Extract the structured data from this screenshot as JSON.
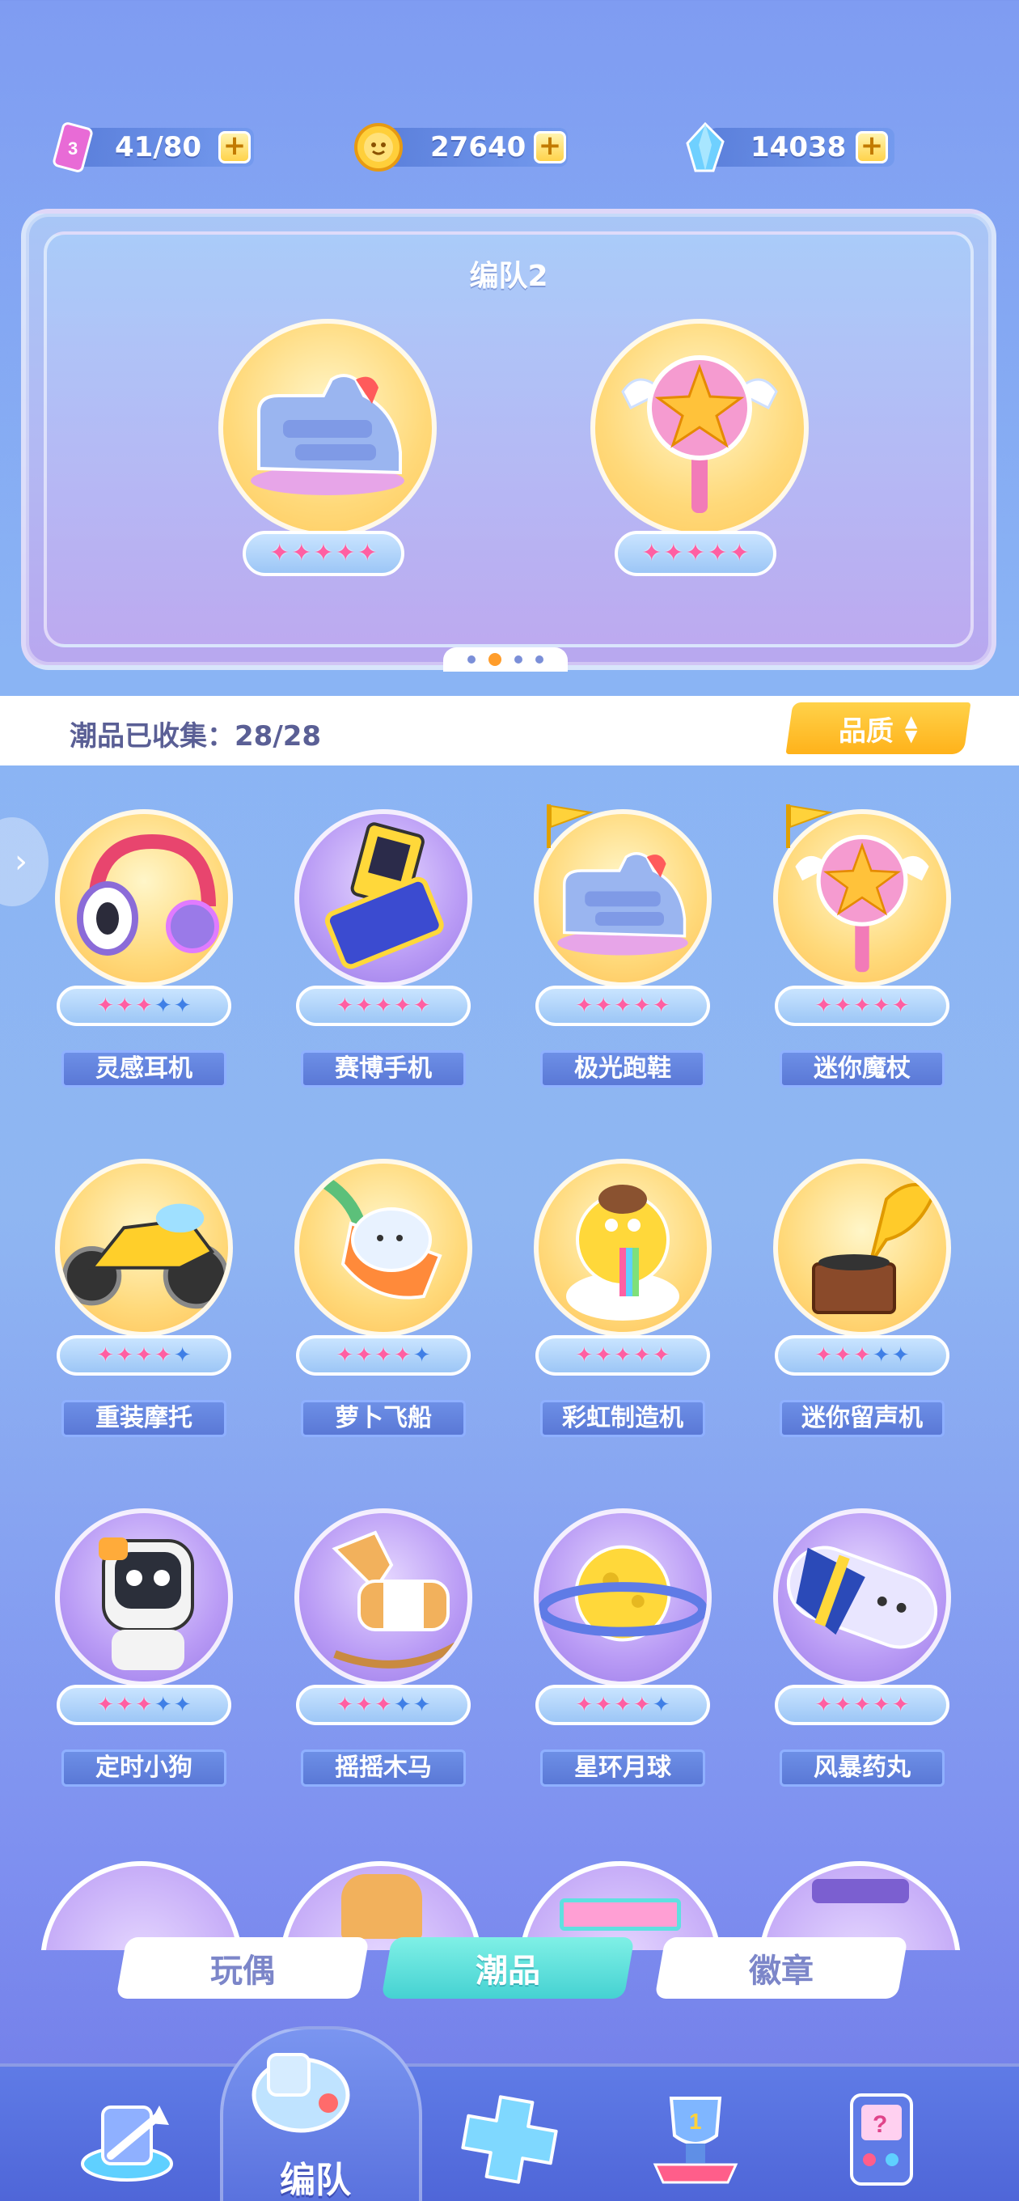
{
  "currencies": [
    {
      "name": "stamina",
      "value": "41/80",
      "icon": "energy-ticket-icon"
    },
    {
      "name": "coins",
      "value": "27640",
      "icon": "gold-coin-icon"
    },
    {
      "name": "crystals",
      "value": "14038",
      "icon": "crystal-icon"
    }
  ],
  "plus_label": "+",
  "team": {
    "title": "编队2",
    "slots": [
      {
        "item": "sneaker",
        "stars": 5,
        "max_stars": 5
      },
      {
        "item": "magic-wand",
        "stars": 5,
        "max_stars": 5
      }
    ],
    "pages": 4,
    "current_page": 2
  },
  "collection": {
    "label": "潮品已收集：28/28",
    "sort_label": "品质",
    "sort_icon": "⇕"
  },
  "items": [
    {
      "name": "灵感耳机",
      "stars": 3,
      "max_stars": 5,
      "bg": "gold",
      "icon": "headphones-icon",
      "flag": false
    },
    {
      "name": "赛博手机",
      "stars": 5,
      "max_stars": 5,
      "bg": "purple",
      "icon": "flip-phone-icon",
      "flag": false
    },
    {
      "name": "极光跑鞋",
      "stars": 5,
      "max_stars": 5,
      "bg": "gold",
      "icon": "sneaker-icon",
      "flag": true
    },
    {
      "name": "迷你魔杖",
      "stars": 5,
      "max_stars": 5,
      "bg": "gold",
      "icon": "magic-wand-icon",
      "flag": true
    },
    {
      "name": "重装摩托",
      "stars": 4,
      "max_stars": 5,
      "bg": "gold",
      "icon": "motorcycle-icon",
      "flag": false
    },
    {
      "name": "萝卜飞船",
      "stars": 4,
      "max_stars": 5,
      "bg": "gold",
      "icon": "carrot-ship-icon",
      "flag": false
    },
    {
      "name": "彩虹制造机",
      "stars": 5,
      "max_stars": 5,
      "bg": "gold",
      "icon": "rainbow-machine-icon",
      "flag": false
    },
    {
      "name": "迷你留声机",
      "stars": 3,
      "max_stars": 5,
      "bg": "gold",
      "icon": "gramophone-icon",
      "flag": false
    },
    {
      "name": "定时小狗",
      "stars": 3,
      "max_stars": 5,
      "bg": "purple",
      "icon": "robot-dog-icon",
      "flag": false
    },
    {
      "name": "摇摇木马",
      "stars": 3,
      "max_stars": 5,
      "bg": "purple",
      "icon": "rocking-horse-icon",
      "flag": false
    },
    {
      "name": "星环月球",
      "stars": 4,
      "max_stars": 5,
      "bg": "purple",
      "icon": "ringed-moon-icon",
      "flag": false
    },
    {
      "name": "风暴药丸",
      "stars": 5,
      "max_stars": 5,
      "bg": "purple",
      "icon": "capsule-icon",
      "flag": false
    }
  ],
  "partial_row_icons": [
    "glove-icon",
    "toast-icon",
    "sign-icon",
    "gumball-machine-icon"
  ],
  "category_tabs": [
    {
      "label": "玩偶",
      "active": false
    },
    {
      "label": "潮品",
      "active": true
    },
    {
      "label": "徽章",
      "active": false
    }
  ],
  "bottom_nav": {
    "active_label": "编队",
    "items": [
      {
        "icon": "arrow-portal-icon"
      },
      {
        "icon": "whistle-icon",
        "active": true
      },
      {
        "icon": "game-pad-icon"
      },
      {
        "icon": "trophy-icon"
      },
      {
        "icon": "arcade-machine-icon"
      }
    ]
  },
  "colors": {
    "background": "#8ab4f4",
    "star_on": "#ff5fa2",
    "star_off": "#3f7fe6",
    "quality_button": "#ffb21a",
    "active_tab": "#45d2d2"
  }
}
